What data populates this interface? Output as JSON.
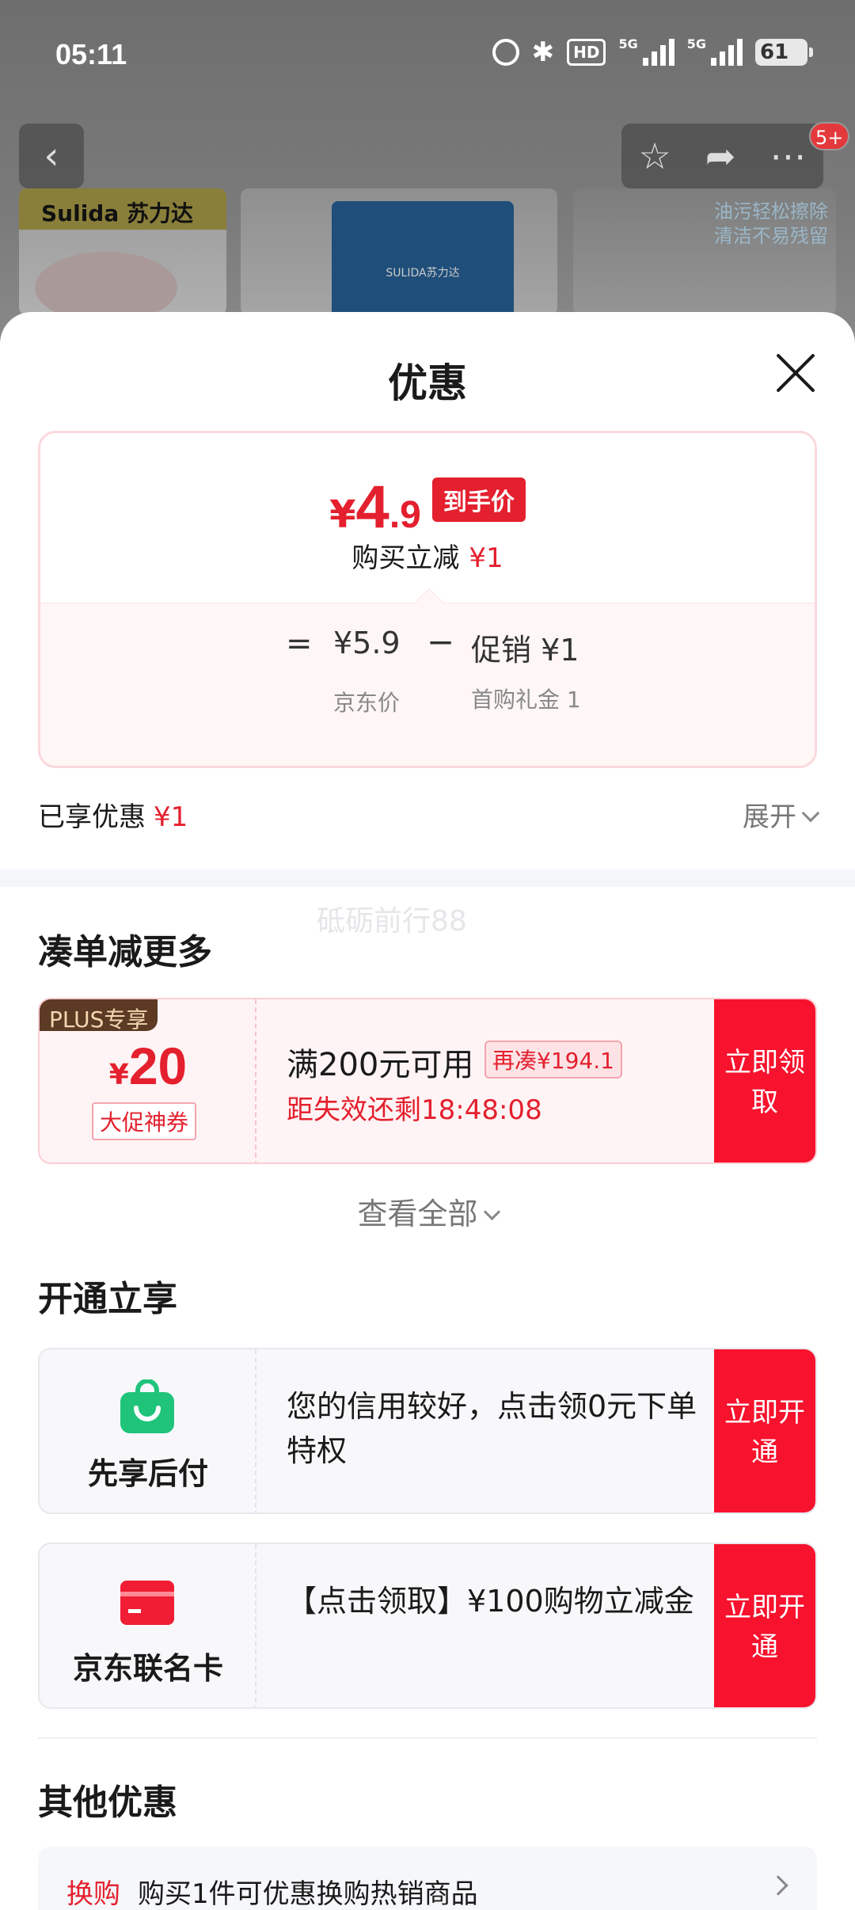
{
  "status_bar": {
    "time": "05:11",
    "hd_label": "HD",
    "net_label": "5G",
    "battery": "61"
  },
  "background": {
    "brand_text": "Sulida 苏力达",
    "pack_text": "SULIDA苏力达",
    "thumb3_text": "油污轻松擦除 清洁不易残留",
    "badge": "5+"
  },
  "sheet": {
    "title": "优惠",
    "price": {
      "currency": "¥",
      "integer": "4",
      "decimal": ".9",
      "tag": "到手价",
      "reduce_label": "购买立减",
      "reduce_value": "¥1"
    },
    "formula": {
      "eq": "=",
      "jd_price": "¥5.9",
      "minus": "−",
      "promo": "促销 ¥1",
      "jd_label": "京东价",
      "promo_label": "首购礼金 1"
    },
    "enjoyed_label": "已享优惠",
    "enjoyed_value": "¥1",
    "expand_label": "展开",
    "watermark": "砥砺前行88",
    "section_more": "凑单减更多",
    "coupon": {
      "plus_tag": "PLUS专享",
      "currency": "¥",
      "amount": "20",
      "label": "大促神券",
      "condition": "满200元可用",
      "extra": "再凑¥194.1",
      "expire": "距失效还剩18:48:08",
      "button": "立即领取"
    },
    "view_all": "查看全部",
    "section_open": "开通立享",
    "services": [
      {
        "name": "先享后付",
        "desc": "您的信用较好，点击领0元下单特权",
        "button": "立即开通",
        "icon": "shopping-bag-icon",
        "color": "#1fc47a"
      },
      {
        "name": "京东联名卡",
        "desc": "【点击领取】¥100购物立减金",
        "button": "立即开通",
        "icon": "credit-card-icon",
        "color": "#f01d35"
      }
    ],
    "section_other": "其他优惠",
    "other": {
      "tag": "换购",
      "text": "购买1件可优惠换购热销商品"
    }
  },
  "colors": {
    "accent": "#e4202e",
    "button": "#f7122d"
  }
}
